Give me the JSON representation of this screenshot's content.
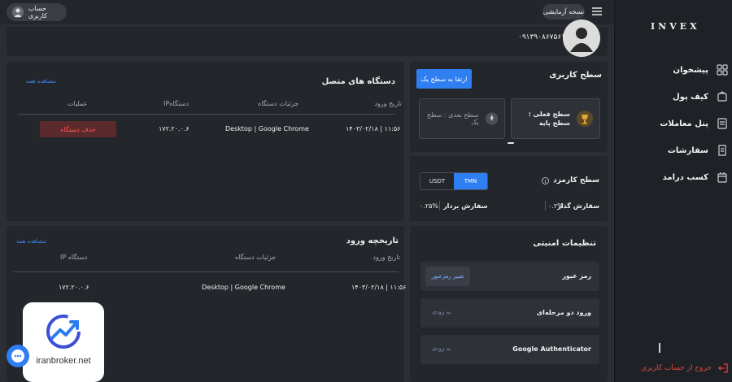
{
  "app": {
    "logo_text": "INVEX"
  },
  "topbar": {
    "user_label": "حساب کاربری",
    "version_label": "نسخه آزمایشی"
  },
  "sidebar": {
    "items": [
      {
        "label": "پیشخوان",
        "icon": "dashboard-icon"
      },
      {
        "label": "کیف پول",
        "icon": "wallet-icon"
      },
      {
        "label": "پنل معاملات",
        "icon": "trade-panel-icon"
      },
      {
        "label": "سفارشات",
        "icon": "orders-icon"
      },
      {
        "label": "کسب درامد",
        "icon": "earn-icon"
      }
    ],
    "logout_label": "خروج از حساب کاربری"
  },
  "profile": {
    "phone": "۰۹۱۳۹۰۸۶۷۵۶۱"
  },
  "user_level": {
    "title": "سطح کاربری",
    "upgrade_button": "ارتقا به سطح یک",
    "current_level": "سطح فعلی : سطح پایه",
    "next_level": "سطح بعدی : سطح یک"
  },
  "fee_level": {
    "title": "سطح کارمزد",
    "tabs": [
      "TMN",
      "USDT"
    ],
    "active_tab": "TMN",
    "maker_label": "سفارش گذار",
    "maker_value": "۰.۲%",
    "taker_label": "سفارش بردار",
    "taker_value": "۰.۲۵%"
  },
  "security": {
    "title": "تنظیمات امنیتی",
    "password_label": "رمز عبور",
    "change_password_button": "تغییر رمزعبور",
    "two_factor_label": "ورود دو مرحله‌ای",
    "google_auth_label": "Google Authenticator",
    "soon_label": "به زودی"
  },
  "devices": {
    "title": "دستگاه های متصل",
    "view_all": "مشاهده همه",
    "headers": [
      "تاریخ ورود",
      "جزئیات دستگاه",
      "IPدستگاه",
      "عملیات"
    ],
    "rows": [
      {
        "date": "۱۴۰۳/۰۲/۱۸ | ۱۱:۵۶",
        "details": "Desktop | Google Chrome",
        "ip": "۱۷۲.۲۰.۰.۶",
        "action": "حذف دستگاه"
      }
    ]
  },
  "login_history": {
    "title": "تاریخچه ورود",
    "view_all": "مشاهده همه",
    "headers": [
      "تاریخ ورود",
      "جزئیات دستگاه",
      "IP دستگاه"
    ],
    "rows": [
      {
        "date": "۱۴۰۳/۰۲/۱۸ | ۱۱:۵۶",
        "details": "Desktop | Google Chrome",
        "ip": "۱۷۲.۲۰.۰.۶"
      }
    ]
  },
  "watermark": {
    "text": "iranbroker.net"
  },
  "colors": {
    "accent": "#2f7ef2",
    "danger": "#e2463f",
    "background": "#2b2f35",
    "card": "#23262b"
  }
}
